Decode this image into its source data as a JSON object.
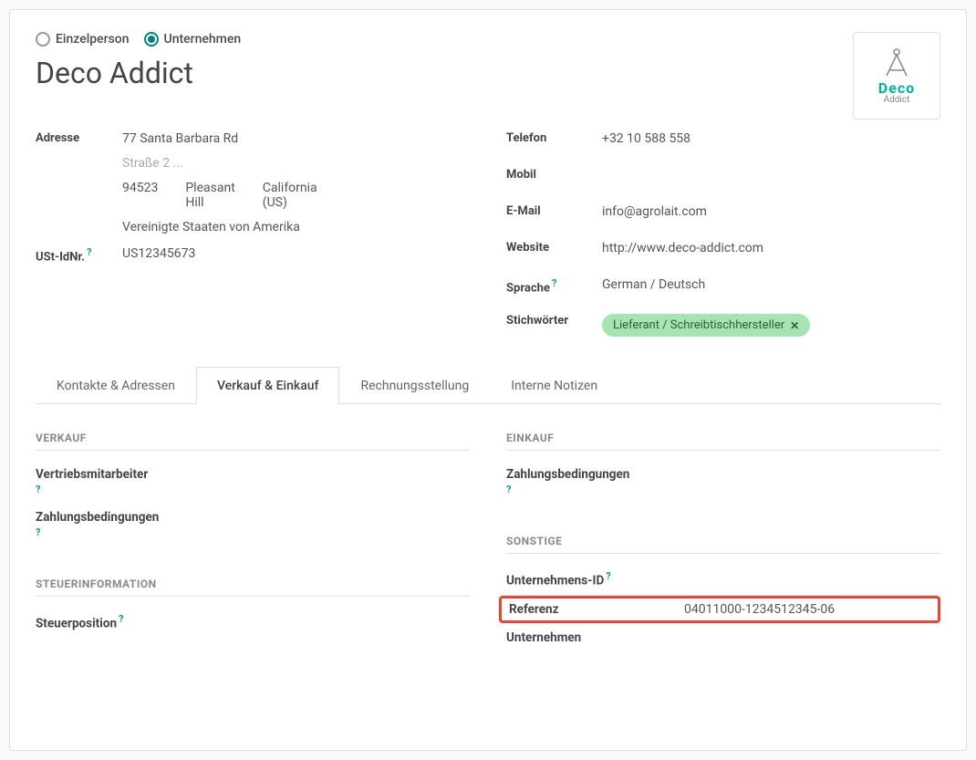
{
  "type_selector": {
    "individual": "Einzelperson",
    "company": "Unternehmen",
    "selected": "company"
  },
  "title": "Deco Addict",
  "logo": {
    "brand": "Deco",
    "sub": "Addict"
  },
  "left_fields": {
    "address_label": "Adresse",
    "address": {
      "street1": "77 Santa Barbara Rd",
      "street2_placeholder": "Straße 2 ...",
      "zip": "94523",
      "city": "Pleasant Hill",
      "state": "California (US)",
      "country": "Vereinigte Staaten von Amerika"
    },
    "vat_label": "USt-IdNr.",
    "vat_help": "?",
    "vat": "US12345673"
  },
  "right_fields": {
    "phone_label": "Telefon",
    "phone": "+32 10 588 558",
    "mobile_label": "Mobil",
    "mobile": "",
    "email_label": "E-Mail",
    "email": "info@agrolait.com",
    "website_label": "Website",
    "website": "http://www.deco-addict.com",
    "lang_label": "Sprache",
    "lang_help": "?",
    "lang": "German / Deutsch",
    "tags_label": "Stichwörter",
    "tag": "Lieferant / Schreibtischhersteller"
  },
  "tabs": {
    "contacts": "Kontakte & Adressen",
    "sales": "Verkauf & Einkauf",
    "invoicing": "Rechnungsstellung",
    "notes": "Interne Notizen",
    "active": "sales"
  },
  "tab_sales": {
    "left": {
      "sales_section": "Verkauf",
      "salesperson_label": "Vertriebsmitarbeiter",
      "salesperson_help": "?",
      "payment_terms_label": "Zahlungsbedingungen",
      "payment_terms_help": "?",
      "tax_section": "Steuerinformation",
      "fiscal_pos_label": "Steuerposition",
      "fiscal_pos_help": "?"
    },
    "right": {
      "purchase_section": "Einkauf",
      "payment_terms_label": "Zahlungsbedingungen",
      "payment_terms_help": "?",
      "misc_section": "Sonstige",
      "company_id_label": "Unternehmens-ID",
      "company_id_help": "?",
      "reference_label": "Referenz",
      "reference_value": "04011000-1234512345-06",
      "company_label": "Unternehmen"
    }
  }
}
